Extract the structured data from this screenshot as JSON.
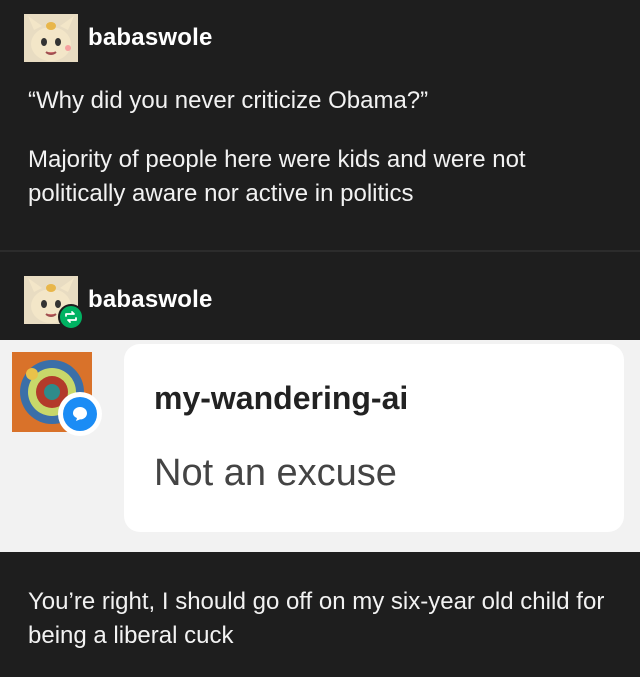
{
  "post1": {
    "username": "babaswole",
    "question": "“Why did you never criticize Obama?”",
    "reply": "Majority of people here were kids and were not politically aware nor active in politics"
  },
  "post2": {
    "username": "babaswole",
    "screenshot": {
      "commenter": "my-wandering-ai",
      "message": "Not an excuse"
    },
    "reply": "You’re right, I should go off on my six-year old child for being a liberal cuck"
  },
  "colors": {
    "background": "#1e1e1e",
    "reblog_badge": "#00b262",
    "chat_badge": "#1b8cf5"
  },
  "icons": {
    "avatar": "meowth-avatar",
    "reblog": "reblog-icon",
    "chat": "chat-bubble-icon"
  }
}
